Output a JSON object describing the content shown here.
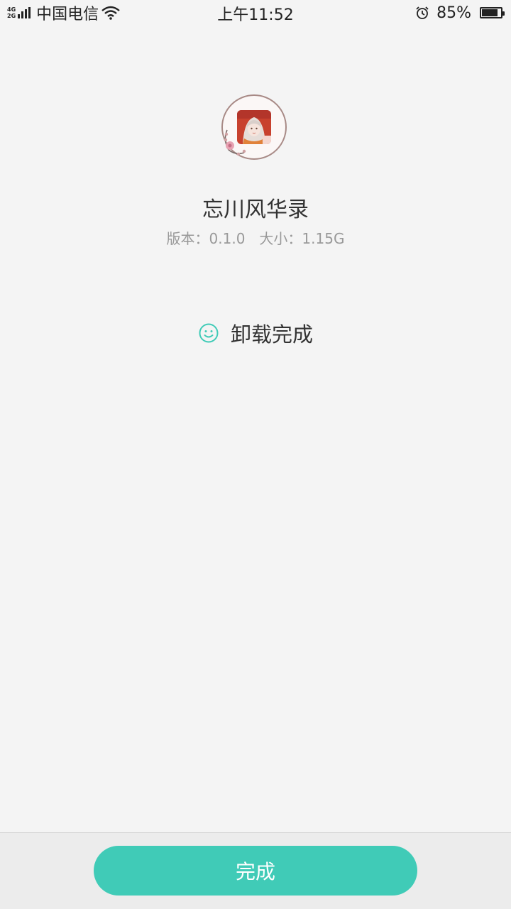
{
  "status_bar": {
    "network_top": "4G",
    "network_bottom": "2G",
    "carrier": "中国电信",
    "time": "上午11:52",
    "battery_percent": "85%",
    "battery_level": 0.85,
    "icons": [
      "signal-icon",
      "wifi-icon",
      "alarm-icon",
      "battery-icon"
    ]
  },
  "app": {
    "icon": "app-icon",
    "name": "忘川风华录",
    "version_label": "版本：0.1.0",
    "size_label": "大小：1.15G"
  },
  "result": {
    "icon": "smile-icon",
    "text": "卸载完成",
    "color": "#40cbb7"
  },
  "footer": {
    "done_label": "完成",
    "button_color": "#40cbb7"
  }
}
